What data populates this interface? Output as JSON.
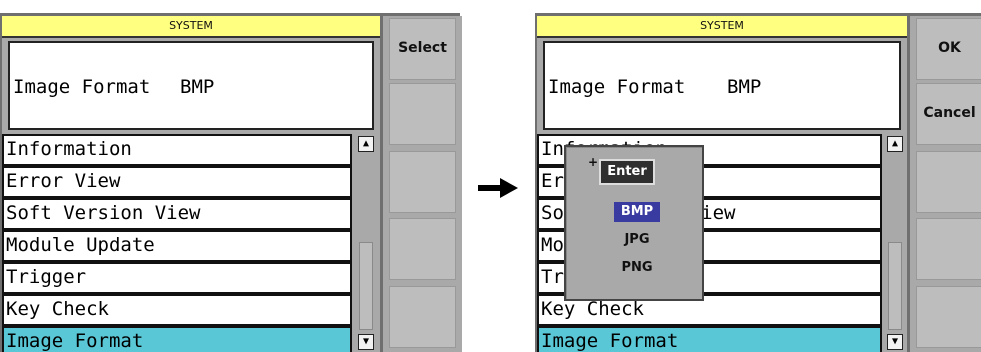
{
  "left_screen": {
    "title": "SYSTEM",
    "info_label": "Image Format",
    "info_value": "BMP",
    "list": [
      "Information",
      "Error View",
      "Soft Version View",
      "Module Update",
      "Trigger",
      "Key Check",
      "Image Format"
    ],
    "selected_item": "Image Format",
    "softkeys": [
      "Select",
      "",
      "",
      "",
      ""
    ]
  },
  "right_screen": {
    "title": "SYSTEM",
    "info_label": "Image Format",
    "info_value": "BMP",
    "list": [
      "Information",
      "Error View",
      "Soft Version View",
      "Module Update",
      "Trigger",
      "Key Check",
      "Image Format"
    ],
    "selected_item": "Image Format",
    "softkeys": [
      "OK",
      "Cancel",
      "",
      "",
      ""
    ],
    "popup": {
      "title": "Enter",
      "marker": "+",
      "options": [
        "BMP",
        "JPG",
        "PNG"
      ],
      "selected": "BMP"
    }
  },
  "transition_icon": "right-arrow-icon",
  "colors": {
    "title_bar": "#ffff80",
    "selected_row": "#59c7d6",
    "popup_highlight": "#3a3ba0",
    "panel_gray": "#a9a9a9"
  }
}
